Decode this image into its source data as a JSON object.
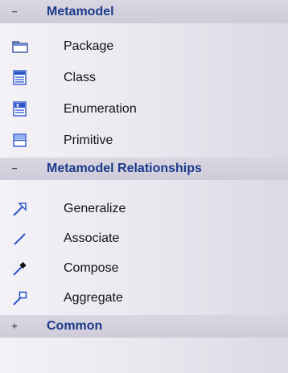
{
  "groups": [
    {
      "title": "Metamodel",
      "state": "expanded",
      "toggle": "−",
      "items": [
        {
          "label": "Package",
          "icon": "package-icon"
        },
        {
          "label": "Class",
          "icon": "class-icon"
        },
        {
          "label": "Enumeration",
          "icon": "enumeration-icon"
        },
        {
          "label": "Primitive",
          "icon": "primitive-icon"
        }
      ]
    },
    {
      "title": "Metamodel Relationships",
      "state": "expanded",
      "toggle": "−",
      "items": [
        {
          "label": "Generalize",
          "icon": "generalize-icon"
        },
        {
          "label": "Associate",
          "icon": "associate-icon"
        },
        {
          "label": "Compose",
          "icon": "compose-icon"
        },
        {
          "label": "Aggregate",
          "icon": "aggregate-icon"
        }
      ]
    },
    {
      "title": "Common",
      "state": "collapsed",
      "toggle": "+",
      "items": []
    }
  ],
  "colors": {
    "header_text": "#1b3a8a",
    "icon_blue": "#2d56c9",
    "panel_bg": "#e9e6ee",
    "header_bg": "#d3cfdc"
  }
}
